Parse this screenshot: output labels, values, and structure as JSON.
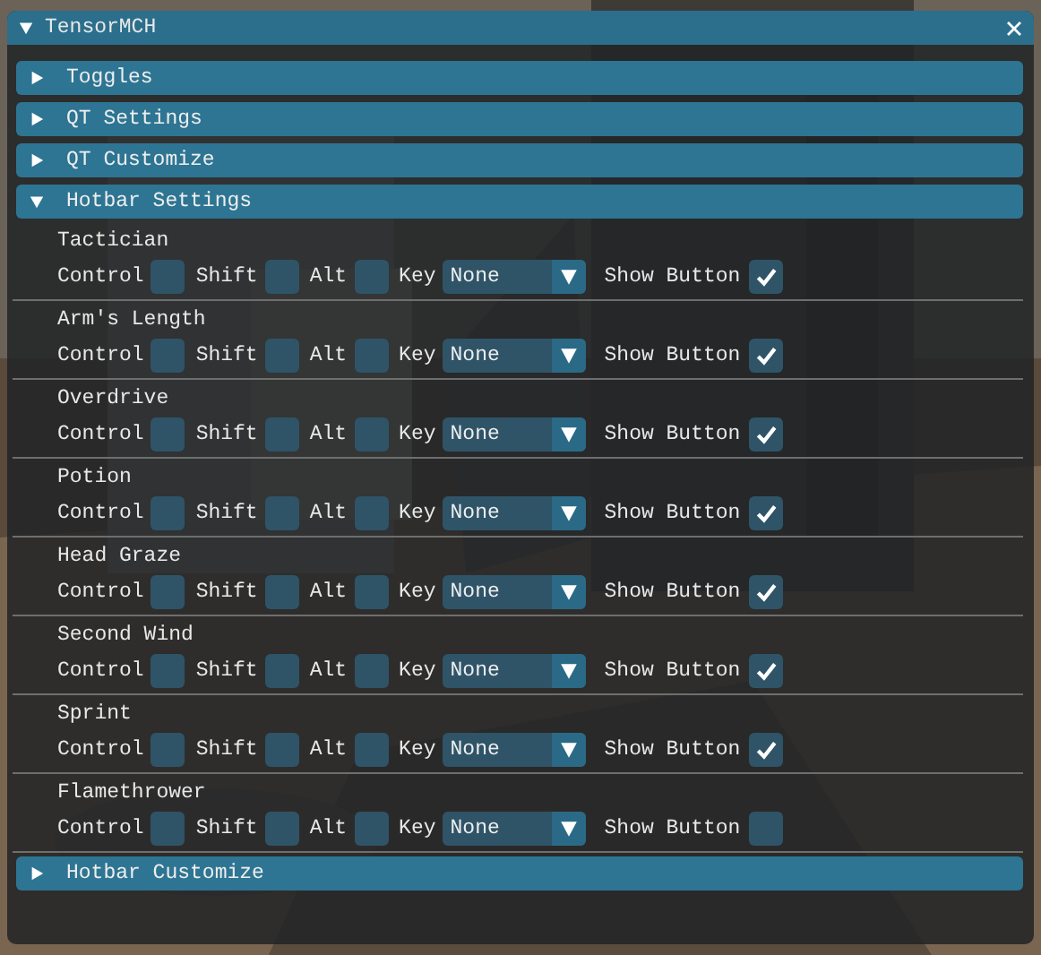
{
  "window": {
    "title": "TensorMCH"
  },
  "sections": [
    {
      "label": "Toggles",
      "expanded": false
    },
    {
      "label": "QT Settings",
      "expanded": false
    },
    {
      "label": "QT Customize",
      "expanded": false
    },
    {
      "label": "Hotbar Settings",
      "expanded": true,
      "items": [
        {
          "name": "Tactician",
          "modifiers": [
            {
              "label": "Control",
              "checked": false
            },
            {
              "label": "Shift",
              "checked": false
            },
            {
              "label": "Alt",
              "checked": false
            }
          ],
          "key_label": "Key",
          "key": "None",
          "show_label": "Show Button",
          "show_button": true
        },
        {
          "name": "Arm's Length",
          "modifiers": [
            {
              "label": "Control",
              "checked": false
            },
            {
              "label": "Shift",
              "checked": false
            },
            {
              "label": "Alt",
              "checked": false
            }
          ],
          "key_label": "Key",
          "key": "None",
          "show_label": "Show Button",
          "show_button": true
        },
        {
          "name": "Overdrive",
          "modifiers": [
            {
              "label": "Control",
              "checked": false
            },
            {
              "label": "Shift",
              "checked": false
            },
            {
              "label": "Alt",
              "checked": false
            }
          ],
          "key_label": "Key",
          "key": "None",
          "show_label": "Show Button",
          "show_button": true
        },
        {
          "name": "Potion",
          "modifiers": [
            {
              "label": "Control",
              "checked": false
            },
            {
              "label": "Shift",
              "checked": false
            },
            {
              "label": "Alt",
              "checked": false
            }
          ],
          "key_label": "Key",
          "key": "None",
          "show_label": "Show Button",
          "show_button": true
        },
        {
          "name": "Head Graze",
          "modifiers": [
            {
              "label": "Control",
              "checked": false
            },
            {
              "label": "Shift",
              "checked": false
            },
            {
              "label": "Alt",
              "checked": false
            }
          ],
          "key_label": "Key",
          "key": "None",
          "show_label": "Show Button",
          "show_button": true
        },
        {
          "name": "Second Wind",
          "modifiers": [
            {
              "label": "Control",
              "checked": false
            },
            {
              "label": "Shift",
              "checked": false
            },
            {
              "label": "Alt",
              "checked": false
            }
          ],
          "key_label": "Key",
          "key": "None",
          "show_label": "Show Button",
          "show_button": true
        },
        {
          "name": "Sprint",
          "modifiers": [
            {
              "label": "Control",
              "checked": false
            },
            {
              "label": "Shift",
              "checked": false
            },
            {
              "label": "Alt",
              "checked": false
            }
          ],
          "key_label": "Key",
          "key": "None",
          "show_label": "Show Button",
          "show_button": true
        },
        {
          "name": "Flamethrower",
          "modifiers": [
            {
              "label": "Control",
              "checked": false
            },
            {
              "label": "Shift",
              "checked": false
            },
            {
              "label": "Alt",
              "checked": false
            }
          ],
          "key_label": "Key",
          "key": "None",
          "show_label": "Show Button",
          "show_button": false
        }
      ]
    },
    {
      "label": "Hotbar Customize",
      "expanded": false
    }
  ]
}
